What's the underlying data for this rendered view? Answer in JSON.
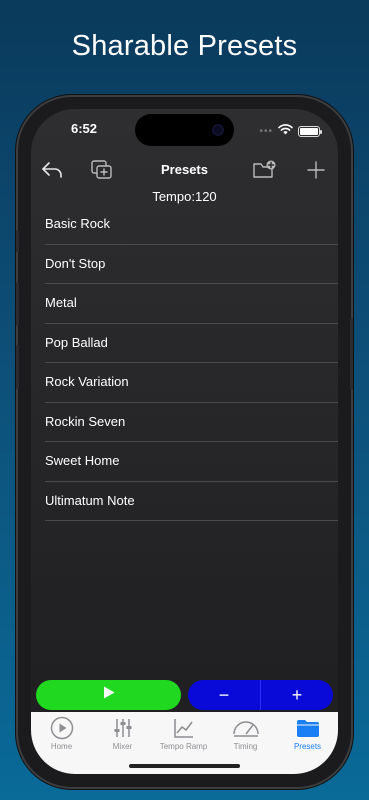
{
  "promo": {
    "title": "Sharable Presets"
  },
  "status_bar": {
    "time": "6:52",
    "dots": "•••"
  },
  "nav": {
    "title": "Presets"
  },
  "tempo_label": "Tempo:120",
  "presets": [
    "Basic Rock",
    "Don't Stop",
    "Metal",
    "Pop Ballad",
    "Rock Variation",
    "Rockin Seven",
    "Sweet Home",
    "Ultimatum Note"
  ],
  "controls": {
    "minus": "−",
    "plus": "+"
  },
  "tabs": [
    {
      "label": "Home",
      "icon": "play-circle-icon",
      "active": false
    },
    {
      "label": "Mixer",
      "icon": "sliders-icon",
      "active": false
    },
    {
      "label": "Tempo Ramp",
      "icon": "chart-line-icon",
      "active": false
    },
    {
      "label": "Timing",
      "icon": "gauge-icon",
      "active": false
    },
    {
      "label": "Presets",
      "icon": "folder-icon",
      "active": true
    }
  ],
  "colors": {
    "play": "#1fd81f",
    "stepper": "#0a0ad8",
    "active_tab": "#1a7ef5",
    "inactive_tab": "#8e8e93",
    "background_top": "#0a3a5c",
    "background_bottom": "#0a6a98"
  }
}
